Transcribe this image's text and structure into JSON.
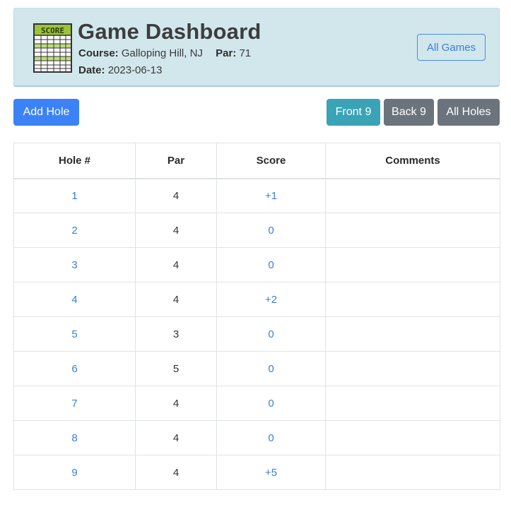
{
  "header": {
    "title": "Game Dashboard",
    "icon_text": "SCORE",
    "course_label": "Course:",
    "course_value": "Galloping Hill, NJ",
    "par_label": "Par:",
    "par_value": "71",
    "date_label": "Date:",
    "date_value": "2023-06-13",
    "all_games_label": "All Games"
  },
  "toolbar": {
    "add_hole_label": "Add Hole",
    "front9_label": "Front 9",
    "back9_label": "Back 9",
    "all_holes_label": "All Holes"
  },
  "table": {
    "columns": [
      "Hole #",
      "Par",
      "Score",
      "Comments"
    ],
    "rows": [
      {
        "hole": "1",
        "par": "4",
        "score": "+1",
        "comments": ""
      },
      {
        "hole": "2",
        "par": "4",
        "score": "0",
        "comments": ""
      },
      {
        "hole": "3",
        "par": "4",
        "score": "0",
        "comments": ""
      },
      {
        "hole": "4",
        "par": "4",
        "score": "+2",
        "comments": ""
      },
      {
        "hole": "5",
        "par": "3",
        "score": "0",
        "comments": ""
      },
      {
        "hole": "6",
        "par": "5",
        "score": "0",
        "comments": ""
      },
      {
        "hole": "7",
        "par": "4",
        "score": "0",
        "comments": ""
      },
      {
        "hole": "8",
        "par": "4",
        "score": "0",
        "comments": ""
      },
      {
        "hole": "9",
        "par": "4",
        "score": "+5",
        "comments": ""
      }
    ]
  },
  "colors": {
    "header_bg": "#d1e7ec",
    "primary": "#3b82f6",
    "info": "#3aa3b6",
    "secondary": "#6b747c",
    "link": "#3b7ddd",
    "icon_green": "#9cc43a"
  },
  "icons": {
    "scorecard": "scorecard-icon"
  }
}
